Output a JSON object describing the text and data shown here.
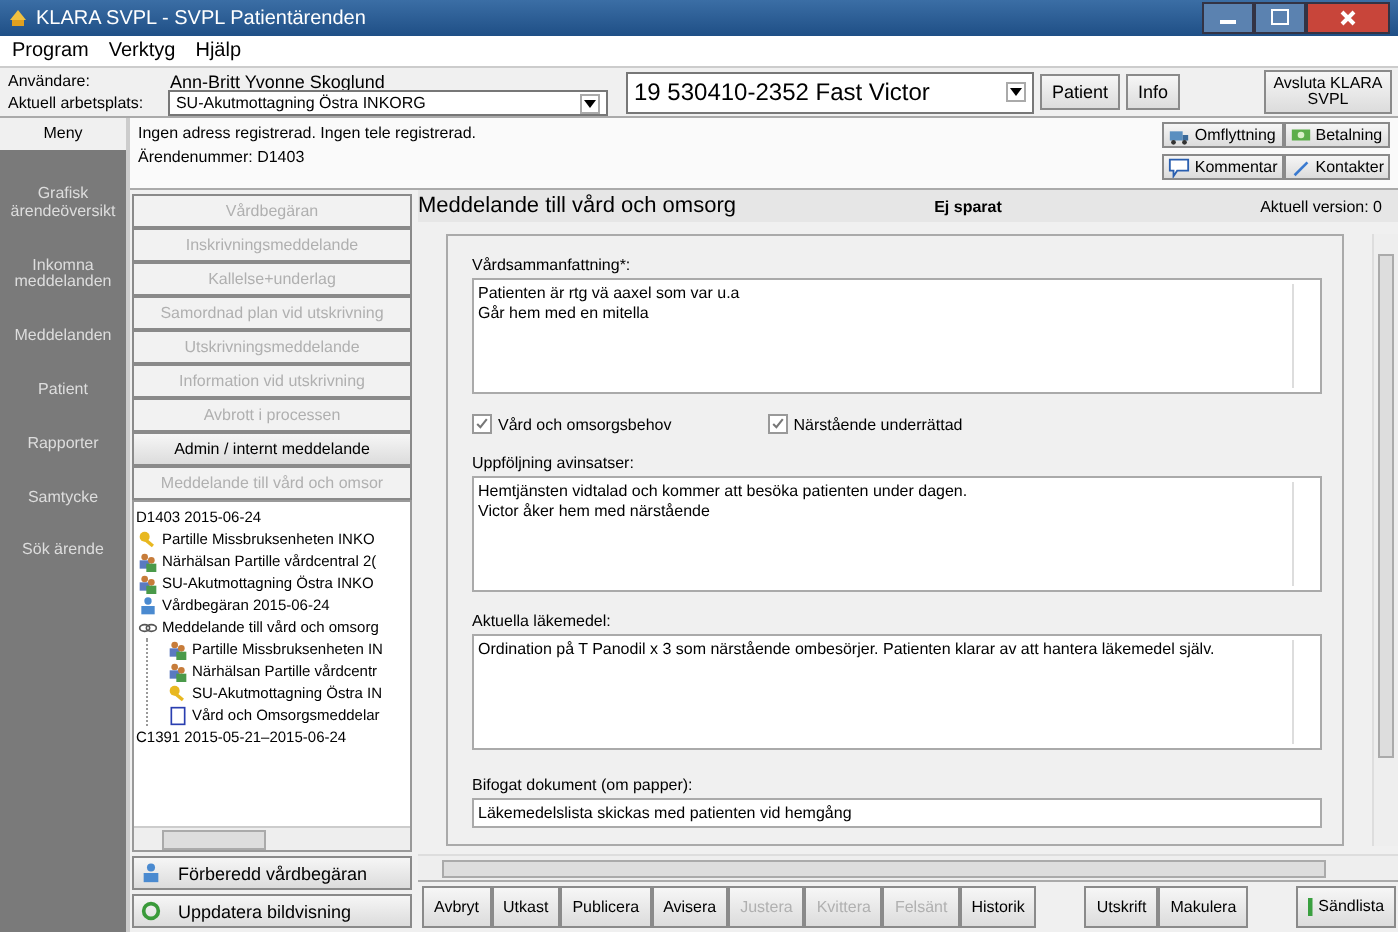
{
  "window": {
    "title": "KLARA SVPL - SVPL Patientärenden"
  },
  "menu": [
    "Program",
    "Verktyg",
    "Hjälp"
  ],
  "header": {
    "user_label": "Användare:",
    "user": "Ann-Britt Yvonne Skoglund",
    "workplace_label": "Aktuell arbetsplats:",
    "workplace": "SU-Akutmottagning Östra INKORG",
    "patient": "19 530410-2352 Fast Victor",
    "buttons": [
      "Patient",
      "Info"
    ],
    "exit": "Avsluta KLARA SVPL"
  },
  "nav": {
    "title": "Meny",
    "items": [
      {
        "label": "Grafisk ärendeöversikt"
      },
      {
        "label": "Inkomna meddelanden"
      },
      {
        "label": "Meddelanden"
      },
      {
        "label": "Patient"
      },
      {
        "label": "Rapporter"
      },
      {
        "label": "Samtycke"
      },
      {
        "label": "Sök ärende"
      }
    ]
  },
  "info": {
    "lines": [
      "Ingen adress registrerad.  Ingen tele registrerad.",
      "Ärendenummer: D1403"
    ],
    "actions": [
      {
        "label": "Omflyttning",
        "kind": "move"
      },
      {
        "label": "Betalning",
        "kind": "money"
      },
      {
        "label": "Kommentar",
        "kind": "comment"
      },
      {
        "label": "Kontakter",
        "kind": "contacts"
      }
    ]
  },
  "case_buttons": [
    {
      "label": "Vårdbegäran",
      "disabled": true
    },
    {
      "label": "Inskrivningsmeddelande",
      "disabled": true
    },
    {
      "label": "Kallelse+underlag",
      "disabled": true
    },
    {
      "label": "Samordnad plan vid utskrivning",
      "disabled": true
    },
    {
      "label": "Utskrivningsmeddelande",
      "disabled": true
    },
    {
      "label": "Information vid utskrivning",
      "disabled": true
    },
    {
      "label": "Avbrott i processen",
      "disabled": true
    },
    {
      "label": "Admin / internt meddelande",
      "disabled": false
    },
    {
      "label": "Meddelande till vård och omsor",
      "disabled": true
    }
  ],
  "tree": [
    {
      "label": "D1403 2015-06-24",
      "children": [
        {
          "label": "Partille Missbruksenheten INKO",
          "kind": "key"
        },
        {
          "label": "Närhälsan Partille vårdcentral 2(",
          "kind": "group"
        },
        {
          "label": "SU-Akutmottagning Östra INKO",
          "kind": "group"
        },
        {
          "label": "Vårdbegäran 2015-06-24",
          "kind": "person"
        },
        {
          "label": "Meddelande till vård och omsorg",
          "kind": "link",
          "children": [
            {
              "label": "Partille Missbruksenheten IN",
              "kind": "group"
            },
            {
              "label": "Närhälsan Partille vårdcentr",
              "kind": "group"
            },
            {
              "label": "SU-Akutmottagning Östra IN",
              "kind": "key"
            },
            {
              "label": "Vård och Omsorgsmeddelar",
              "kind": "document"
            }
          ]
        }
      ]
    },
    {
      "label": "C1391 2015-05-21–2015-06-24"
    }
  ],
  "side_buttons": [
    {
      "label": "Förberedd vårdbegäran",
      "kind": "person"
    },
    {
      "label": "Uppdatera bildvisning",
      "kind": "refresh"
    }
  ],
  "document": {
    "title": "Meddelande till vård och omsorg",
    "status": "Ej sparat",
    "version": "Aktuell version: 0",
    "summary": {
      "label": "Vårdsammanfattning*:",
      "lines": [
        "Patienten är rtg vä aaxel som var u.a",
        "Går hem med en mitella"
      ]
    },
    "checks": [
      {
        "label": "Vård och omsorgsbehov",
        "checked": true
      },
      {
        "label": "Närstående underrättad",
        "checked": true
      }
    ],
    "followup": {
      "label": "Uppföljning avinsatser:",
      "lines": [
        "Hemtjänsten vidtalad och kommer att besöka patienten under dagen.",
        "Victor åker hem med närstående"
      ]
    },
    "meds": {
      "label": "Aktuella läkemedel:",
      "lines": [
        "Ordination på T Panodil x 3 som närstående ombesörjer. Patienten klarar av att hantera läkemedel själv."
      ]
    },
    "attachment": {
      "label": "Bifogat dokument (om papper):",
      "value": "Läkemedelslista skickas med patienten vid hemgång"
    }
  },
  "footer": [
    {
      "buttons": [
        {
          "label": "Avbryt",
          "disabled": false
        },
        {
          "label": "Utkast",
          "disabled": false
        },
        {
          "label": "Publicera",
          "disabled": false
        },
        {
          "label": "Avisera",
          "disabled": false
        },
        {
          "label": "Justera",
          "disabled": true
        },
        {
          "label": "Kvittera",
          "disabled": true
        },
        {
          "label": "Felsänt",
          "disabled": true
        },
        {
          "label": "Historik",
          "disabled": false
        }
      ]
    },
    {
      "buttons": [
        {
          "label": "Utskrift",
          "disabled": false
        },
        {
          "label": "Makulera",
          "disabled": false
        }
      ]
    },
    {
      "buttons": [
        {
          "label": "Sändlista",
          "disabled": false,
          "kind": "list"
        }
      ]
    }
  ]
}
